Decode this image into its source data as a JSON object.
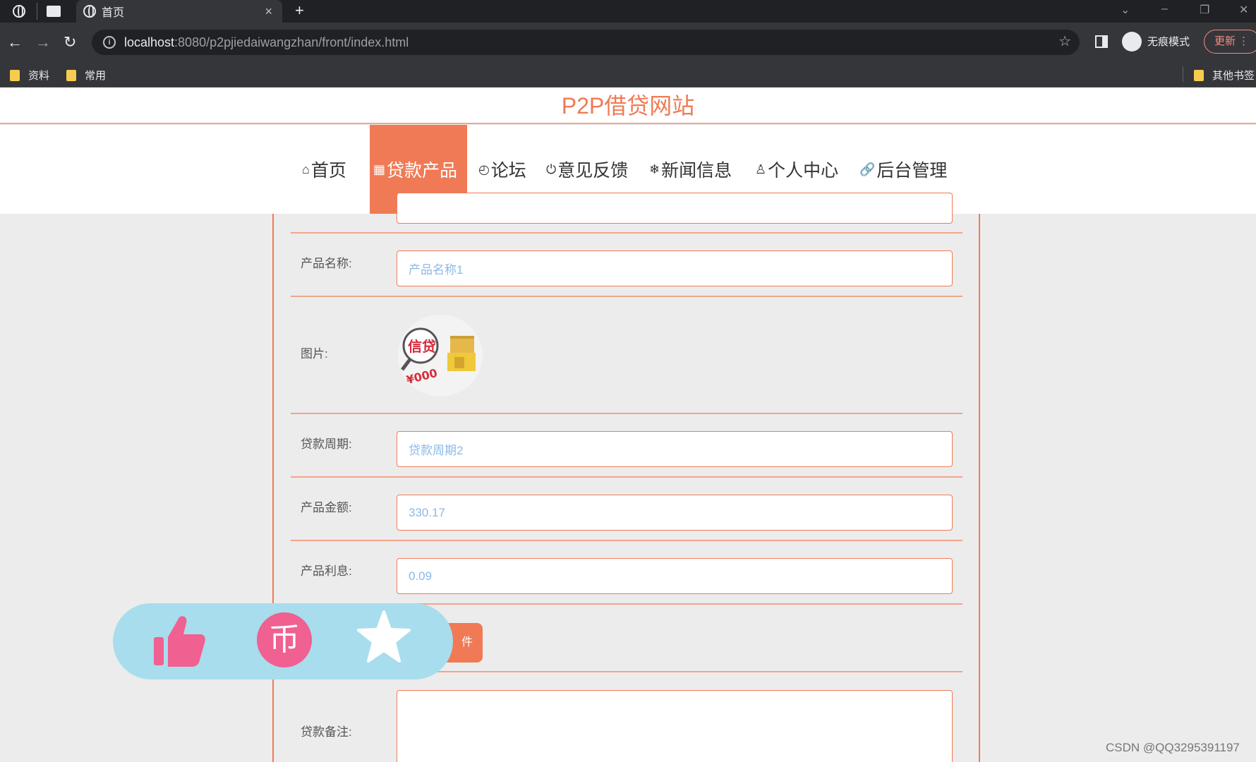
{
  "browser": {
    "tab_title": "首页",
    "tab_close": "×",
    "new_tab": "+",
    "url_host": "localhost",
    "url_rest": ":8080/p2pjiedaiwangzhan/front/index.html",
    "incognito_label": "无痕模式",
    "update_label": "更新",
    "bookmarks": [
      "资料",
      "常用"
    ],
    "other_bookmarks": "其他书签"
  },
  "site": {
    "title": "P2P借贷网站",
    "accent_color": "#f07a55",
    "nav": [
      {
        "label": "首页",
        "icon": "home-icon"
      },
      {
        "label": "贷款产品",
        "icon": "calendar-icon",
        "active": true
      },
      {
        "label": "论坛",
        "icon": "gauge-icon"
      },
      {
        "label": "意见反馈",
        "icon": "power-icon"
      },
      {
        "label": "新闻信息",
        "icon": "snowflake-icon"
      },
      {
        "label": "个人中心",
        "icon": "user-icon"
      },
      {
        "label": "后台管理",
        "icon": "link-icon"
      }
    ]
  },
  "form": {
    "product_name": {
      "label": "产品名称:",
      "value": "产品名称1"
    },
    "image": {
      "label": "图片:",
      "text_top": "信贷",
      "text_bottom": "¥000"
    },
    "loan_period": {
      "label": "贷款周期:",
      "value": "贷款周期2"
    },
    "product_amount": {
      "label": "产品金额:",
      "value": "330.17"
    },
    "product_interest": {
      "label": "产品利息:",
      "value": "0.09"
    },
    "upload_button": "件",
    "loan_remark": {
      "label": "贷款备注:",
      "value": ""
    }
  },
  "overlay": {
    "coin_symbol": "币"
  },
  "watermark": "CSDN @QQ3295391197"
}
